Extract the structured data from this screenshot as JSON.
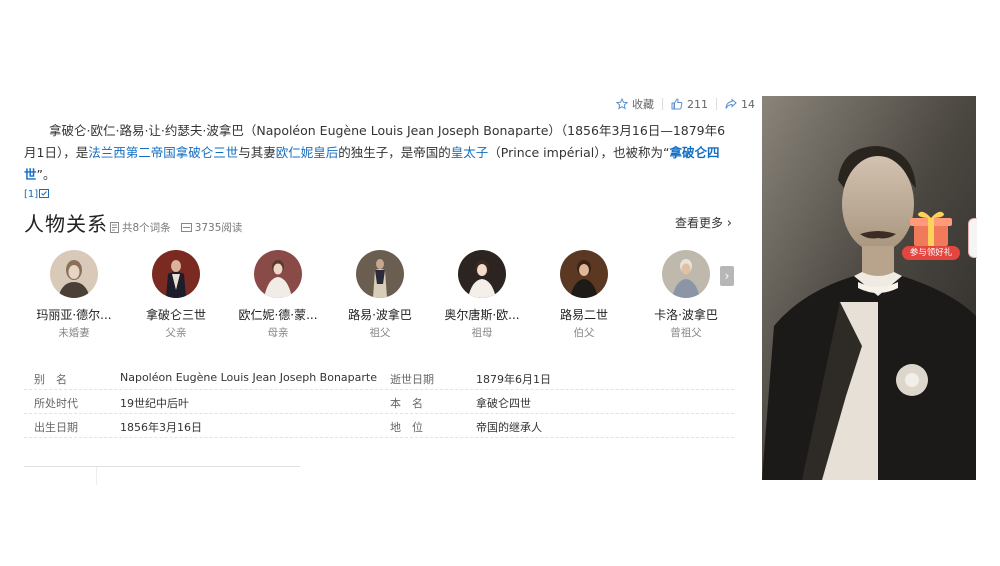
{
  "stats": {
    "collect_label": "收藏",
    "like_count": "211",
    "share_count": "14"
  },
  "intro": {
    "t1": "拿破仑·欧仁·路易·让·约瑟夫·波拿巴（Napoléon Eugène Louis Jean Joseph Bonaparte）（1856年3月16日—1879年6月1日），是",
    "link1": "法兰西第二帝国",
    "link2": "拿破仑三世",
    "t2": "与其妻",
    "link3": "欧仁妮皇后",
    "t3": "的独生子，是帝国的",
    "link4": "皇太子",
    "t4": "（Prince impérial），也被称为“",
    "bold1": "拿破仑四世",
    "t5": "”。",
    "cite": "[1]"
  },
  "relations": {
    "title": "人物关系",
    "entries_text": "共8个词条",
    "reads_text": "3735阅读",
    "see_more": "查看更多",
    "people": [
      {
        "name": "玛丽亚·德尔...",
        "relation": "未婚妻"
      },
      {
        "name": "拿破仑三世",
        "relation": "父亲"
      },
      {
        "name": "欧仁妮·德·蒙...",
        "relation": "母亲"
      },
      {
        "name": "路易·波拿巴",
        "relation": "祖父"
      },
      {
        "name": "奥尔唐斯·欧...",
        "relation": "祖母"
      },
      {
        "name": "路易二世",
        "relation": "伯父"
      },
      {
        "name": "卡洛·波拿巴",
        "relation": "曾祖父"
      }
    ]
  },
  "info": {
    "rows": [
      {
        "k1": "别　名",
        "v1": "Napoléon Eugène Louis Jean Joseph Bonaparte",
        "k2": "逝世日期",
        "v2": "1879年6月1日"
      },
      {
        "k1": "所处时代",
        "v1": "19世纪中后叶",
        "k2": "本　名",
        "v2": "拿破仑四世"
      },
      {
        "k1": "出生日期",
        "v1": "1856年3月16日",
        "k2": "地　位",
        "v2": "帝国的继承人"
      }
    ]
  },
  "gift": {
    "label": "参与领好礼"
  },
  "colors": {
    "link": "#136ec2",
    "gift_red": "#e2463f"
  }
}
